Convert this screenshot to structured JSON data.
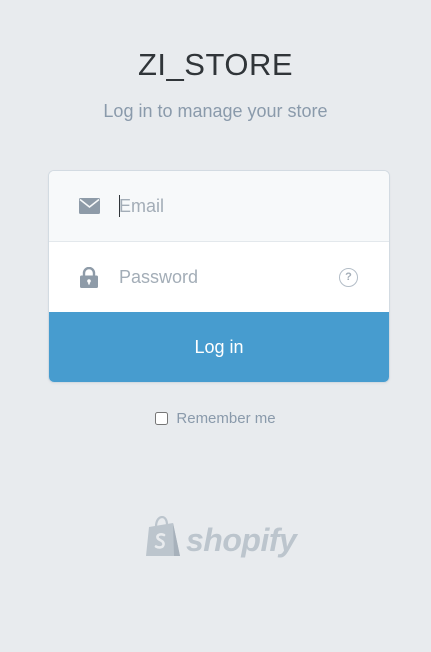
{
  "header": {
    "store_name": "ZI_STORE",
    "subtitle": "Log in to manage your store"
  },
  "form": {
    "email": {
      "placeholder": "Email",
      "value": "",
      "icon": "envelope-icon"
    },
    "password": {
      "placeholder": "Password",
      "value": "",
      "icon": "lock-icon",
      "help_icon": "question-mark-icon",
      "help_glyph": "?"
    },
    "submit_label": "Log in",
    "remember_me": {
      "label": "Remember me",
      "checked": false
    }
  },
  "footer": {
    "brand": "shopify",
    "logo_icon": "shopify-bag-icon"
  },
  "colors": {
    "background": "#e8ebee",
    "accent": "#479ccf",
    "muted_text": "#8a9aab",
    "title_text": "#303539"
  }
}
